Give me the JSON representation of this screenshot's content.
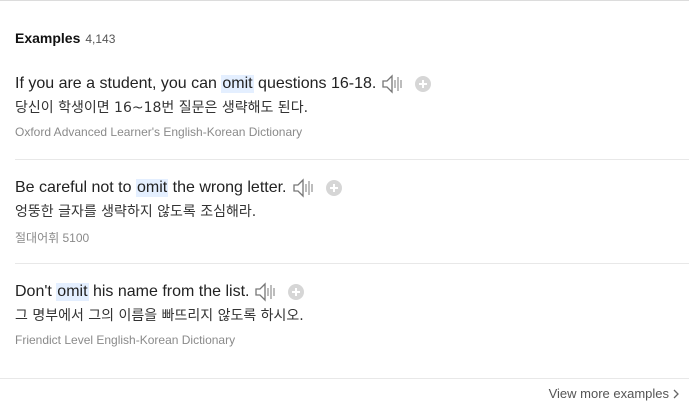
{
  "header": {
    "title": "Examples",
    "count": "4,143"
  },
  "examples": [
    {
      "before": "If you are a student, you can ",
      "highlight": "omit",
      "after": " questions 16-18.",
      "translation": "당신이 학생이면 16~18번 질문은 생략해도 된다.",
      "source": "Oxford Advanced Learner's English-Korean Dictionary"
    },
    {
      "before": "Be careful not to ",
      "highlight": "omit",
      "after": " the wrong letter.",
      "translation": "엉뚱한 글자를 생략하지 않도록 조심해라.",
      "source": "절대어휘 5100"
    },
    {
      "before": "Don't ",
      "highlight": "omit",
      "after": " his name from the list.",
      "translation": "그 명부에서 그의 이름을 빠뜨리지 않도록 하시오.",
      "source": "Friendict Level English-Korean Dictionary"
    }
  ],
  "footer": {
    "more_label": "View more examples"
  },
  "icons": {
    "speaker": "speaker-icon",
    "add": "plus-circle-icon",
    "chevron": "chevron-right-icon"
  },
  "colors": {
    "highlight_bg": "#e4efff",
    "source_text": "#8a8a8a",
    "plus_icon": "#d6d6d6"
  }
}
